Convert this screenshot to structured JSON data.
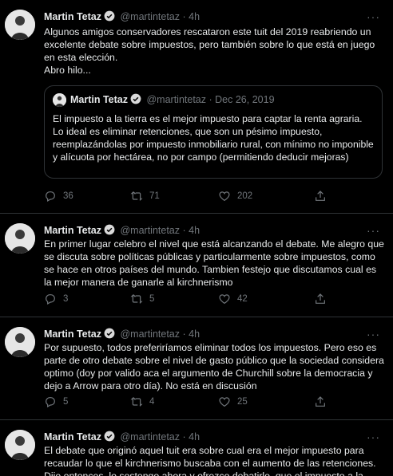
{
  "tweets": [
    {
      "name": "Martin Tetaz",
      "handle": "@martintetaz",
      "dot": "·",
      "time": "4h",
      "more": "···",
      "text": "Algunos amigos conservadores rescataron este tuit del 2019 reabriendo un excelente debate sobre impuestos, pero también sobre lo que está en juego en esta elección.\nAbro hilo...",
      "quote": {
        "name": "Martin Tetaz",
        "handle": "@martintetaz",
        "dot": "·",
        "date": "Dec 26, 2019",
        "text": "El impuesto a la tierra es el mejor impuesto para captar la renta agraria. Lo ideal es eliminar retenciones, que son un pésimo impuesto, reemplazándolas por impuesto inmobiliario rural, con mínimo no imponible y alícuota por hectárea, no por campo (permitiendo deducir mejoras)"
      },
      "replies": "36",
      "retweets": "71",
      "likes": "202"
    },
    {
      "name": "Martin Tetaz",
      "handle": "@martintetaz",
      "dot": "·",
      "time": "4h",
      "more": "···",
      "text": "En primer lugar celebro el nivel que está alcanzando el debate. Me alegro que se discuta sobre políticas públicas y particularmente sobre impuestos, como se hace en otros países del mundo. Tambien festejo que discutamos cual es la mejor manera de ganarle al kirchnerismo",
      "replies": "3",
      "retweets": "5",
      "likes": "42"
    },
    {
      "name": "Martin Tetaz",
      "handle": "@martintetaz",
      "dot": "·",
      "time": "4h",
      "more": "···",
      "text": "Por supuesto, todos preferiríamos eliminar todos los impuestos. Pero eso es parte de otro debate sobre el nivel de gasto público que la sociedad considera optimo (doy por valido aca el argumento de Churchill sobre la democracia y dejo a Arrow para otro día). No está en discusión",
      "replies": "5",
      "retweets": "4",
      "likes": "25"
    },
    {
      "name": "Martin Tetaz",
      "handle": "@martintetaz",
      "dot": "·",
      "time": "4h",
      "more": "···",
      "text": "El debate que originó aquel tuit era sobre cual era el mejor impuesto para recaudar lo que el kirchnerismo buscaba con el aumento de las retenciones. Dije entonces, lo sostengo ahora y ofrezco debatirlo, que el impuesto a la"
    }
  ],
  "icons": {
    "reply": "reply-icon",
    "retweet": "retweet-icon",
    "like": "heart-icon",
    "share": "share-icon",
    "verified": "verified-badge-icon"
  },
  "colors": {
    "background": "#000000",
    "text": "#e7e9ea",
    "muted": "#71767b",
    "border": "#2f3336",
    "verified": "#d9d9d9"
  }
}
